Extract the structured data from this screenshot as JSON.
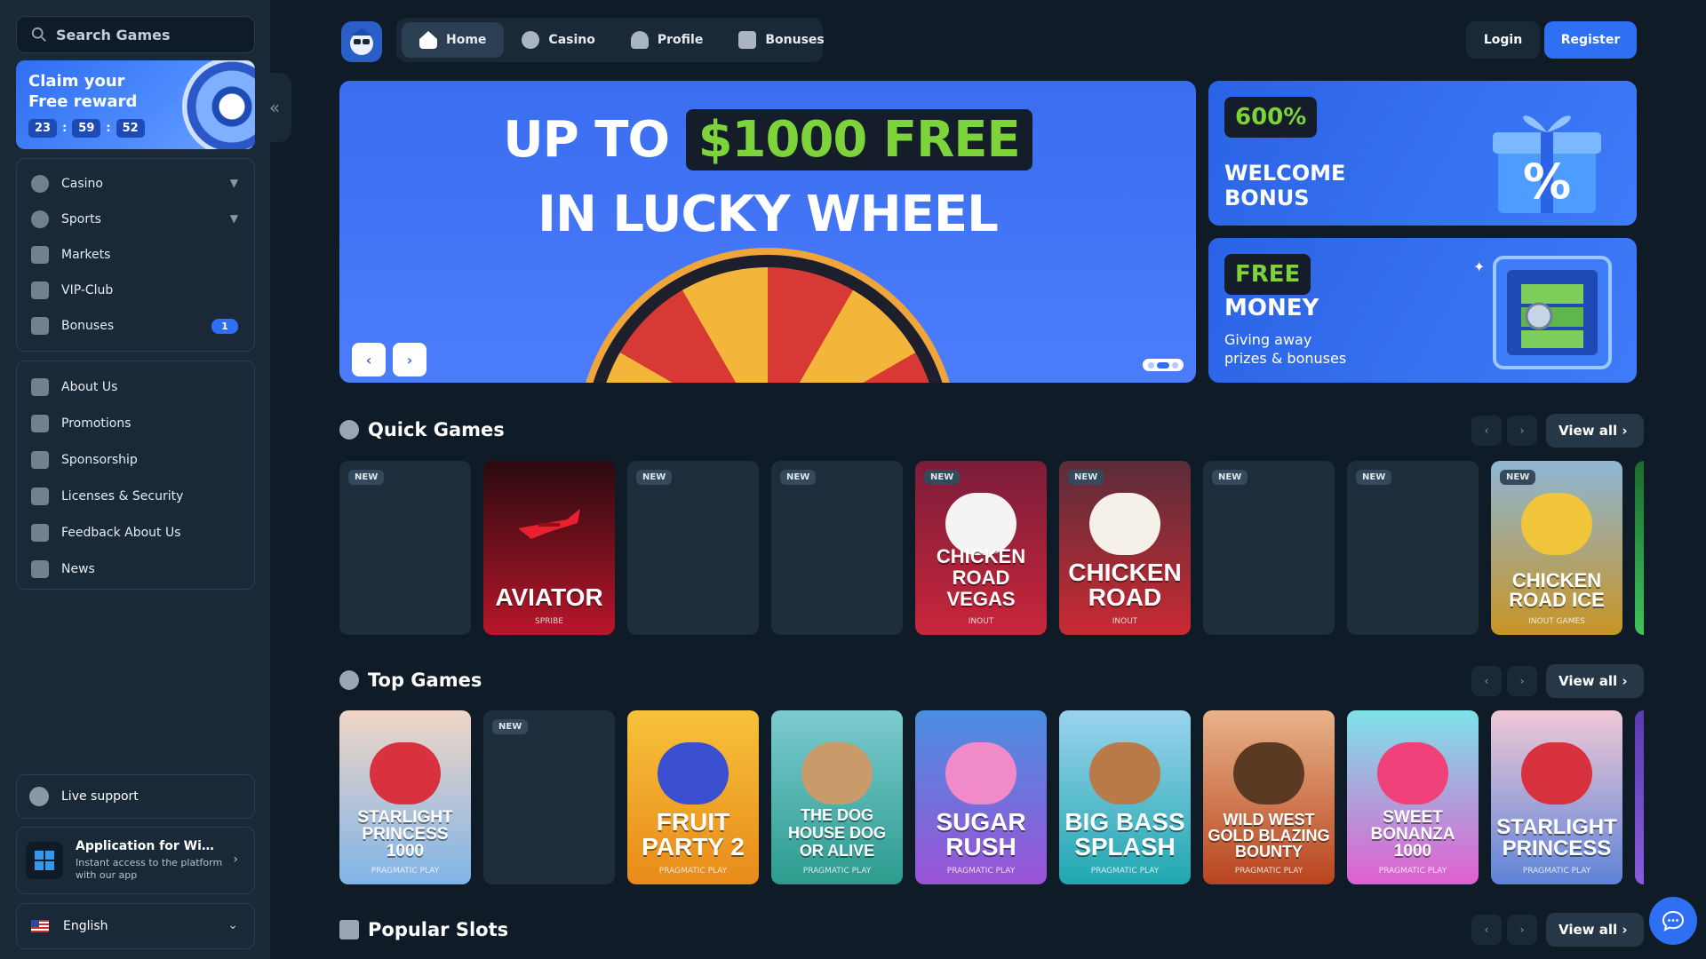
{
  "search": {
    "placeholder": "Search Games"
  },
  "reward": {
    "title": "Claim your Free reward",
    "timer": [
      "23",
      "59",
      "52"
    ]
  },
  "sidebar": {
    "main": [
      {
        "label": "Casino",
        "icon": "casino-chip-icon",
        "expandable": true
      },
      {
        "label": "Sports",
        "icon": "globe-icon",
        "expandable": true
      },
      {
        "label": "Markets",
        "icon": "chart-bars-icon",
        "expandable": false
      },
      {
        "label": "VIP-Club",
        "icon": "crown-icon",
        "expandable": false
      },
      {
        "label": "Bonuses",
        "icon": "gift-icon",
        "badge": "1"
      }
    ],
    "info": [
      {
        "label": "About Us",
        "icon": "book-icon"
      },
      {
        "label": "Promotions",
        "icon": "ticket-icon"
      },
      {
        "label": "Sponsorship",
        "icon": "medal-icon"
      },
      {
        "label": "Licenses & Security",
        "icon": "shield-icon"
      },
      {
        "label": "Feedback About Us",
        "icon": "chat-bubble-icon"
      },
      {
        "label": "News",
        "icon": "newspaper-icon"
      }
    ],
    "support": "Live support",
    "app": {
      "title": "Application for Windows",
      "subtitle": "Instant access to the platform with our app"
    },
    "language": "English"
  },
  "header": {
    "tabs": [
      {
        "label": "Home",
        "active": true
      },
      {
        "label": "Casino",
        "active": false
      },
      {
        "label": "Profile",
        "active": false
      },
      {
        "label": "Bonuses",
        "active": false
      }
    ],
    "login": "Login",
    "register": "Register"
  },
  "hero": {
    "line1_prefix": "UP TO",
    "line1_highlight": "$1000 FREE",
    "line2": "IN LUCKY WHEEL",
    "prev": "‹",
    "next": "›"
  },
  "banners": {
    "welcome": {
      "pill": "600%",
      "title": "WELCOME BONUS"
    },
    "money": {
      "pill": "FREE",
      "title": "MONEY",
      "subtitle": "Giving away prizes & bonuses"
    }
  },
  "sections": {
    "quick": {
      "title": "Quick Games",
      "view_all": "View all"
    },
    "top": {
      "title": "Top Games",
      "view_all": "View all"
    },
    "popular": {
      "title": "Popular Slots",
      "view_all": "View all"
    }
  },
  "new_label": "NEW",
  "quick_games": [
    {
      "name": "",
      "provider": "",
      "new": true
    },
    {
      "name": "AVIATOR",
      "provider": "SPRIBE",
      "new": false,
      "color": "#b8162a"
    },
    {
      "name": "",
      "provider": "",
      "new": true
    },
    {
      "name": "",
      "provider": "",
      "new": true
    },
    {
      "name": "CHICKEN ROAD VEGAS",
      "provider": "INOUT",
      "new": true,
      "color": "#c9263a"
    },
    {
      "name": "CHICKEN ROAD",
      "provider": "INOUT",
      "new": true,
      "color": "#c92a32"
    },
    {
      "name": "",
      "provider": "",
      "new": true
    },
    {
      "name": "",
      "provider": "",
      "new": true
    },
    {
      "name": "CHICKEN ROAD ICE",
      "provider": "INOUT GAMES",
      "new": true,
      "color": "#c79425"
    }
  ],
  "top_games": [
    {
      "name": "STARLIGHT PRINCESS 1000",
      "provider": "PRAGMATIC PLAY",
      "new": false,
      "color": "#7fb4e8"
    },
    {
      "name": "",
      "provider": "",
      "new": true
    },
    {
      "name": "FRUIT PARTY 2",
      "provider": "PRAGMATIC PLAY",
      "new": false,
      "color": "#e88a1a"
    },
    {
      "name": "THE DOG HOUSE DOG OR ALIVE",
      "provider": "PRAGMATIC PLAY",
      "new": false,
      "color": "#2c9b8e"
    },
    {
      "name": "SUGAR RUSH",
      "provider": "PRAGMATIC PLAY",
      "new": false,
      "color": "#9b52d6"
    },
    {
      "name": "BIG BASS SPLASH",
      "provider": "PRAGMATIC PLAY",
      "new": false,
      "color": "#1fa7b0"
    },
    {
      "name": "WILD WEST GOLD BLAZING BOUNTY",
      "provider": "PRAGMATIC PLAY",
      "new": false,
      "color": "#b8441f"
    },
    {
      "name": "SWEET BONANZA 1000",
      "provider": "PRAGMATIC PLAY",
      "new": false,
      "color": "#e05fcf"
    },
    {
      "name": "STARLIGHT PRINCESS",
      "provider": "PRAGMATIC PLAY",
      "new": false,
      "color": "#5e83d8"
    }
  ]
}
